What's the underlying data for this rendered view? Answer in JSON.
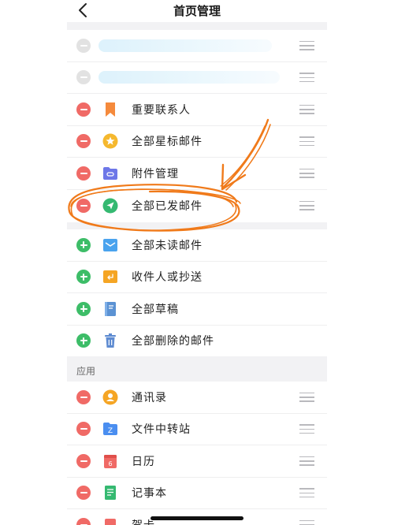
{
  "header": {
    "title": "首页管理",
    "back_icon": "chevron-left-icon"
  },
  "colors": {
    "remove": "#f06a66",
    "add": "#3dbd68",
    "annotation": "#f07a1a"
  },
  "mail_items": [
    {
      "label": "",
      "icon": "blurred-icon",
      "op": "remove",
      "color": "#dbe8f2"
    },
    {
      "label": "",
      "icon": "blurred-icon",
      "op": "remove",
      "color": "#dbe8f2"
    },
    {
      "label": "重要联系人",
      "icon": "bookmark-icon",
      "op": "remove",
      "color": "#f58a3c"
    },
    {
      "label": "全部星标邮件",
      "icon": "star-icon",
      "op": "remove",
      "color": "#f5b82e"
    },
    {
      "label": "附件管理",
      "icon": "attachment-icon",
      "op": "remove",
      "color": "#6d77e8"
    },
    {
      "label": "全部已发邮件",
      "icon": "sent-icon",
      "op": "remove",
      "color": "#35b971"
    },
    {
      "label": "全部未读邮件",
      "icon": "unread-icon",
      "op": "add",
      "color": "#4aa3ee"
    },
    {
      "label": "收件人或抄送",
      "icon": "reply-icon",
      "op": "add",
      "color": "#f5a524"
    },
    {
      "label": "全部草稿",
      "icon": "draft-icon",
      "op": "add",
      "color": "#5b92d3"
    },
    {
      "label": "全部删除的邮件",
      "icon": "trash-icon",
      "op": "add",
      "color": "#5e8bd1"
    }
  ],
  "section_apps": {
    "title": "应用"
  },
  "app_items": [
    {
      "label": "通讯录",
      "icon": "contacts-icon",
      "op": "remove",
      "color": "#f5a524"
    },
    {
      "label": "文件中转站",
      "icon": "folder-icon",
      "op": "remove",
      "color": "#4a8ef0",
      "glyph": "Z"
    },
    {
      "label": "日历",
      "icon": "calendar-icon",
      "op": "remove",
      "color": "#f06a66",
      "glyph": "6"
    },
    {
      "label": "记事本",
      "icon": "notepad-icon",
      "op": "remove",
      "color": "#35b971"
    },
    {
      "label": "贺卡",
      "icon": "card-icon",
      "op": "remove",
      "color": "#f06a66"
    }
  ]
}
